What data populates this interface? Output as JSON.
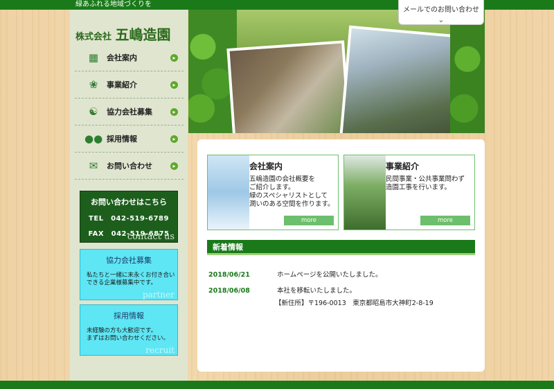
{
  "header": {
    "tagline": "緑あふれる地域づくりを",
    "mail_tab": "メールでのお問い合わせ"
  },
  "sidebar": {
    "logo_prefix": "株式会社",
    "logo_name": "五嶋造園",
    "nav": [
      {
        "label": "会社案内",
        "icon": "building-icon"
      },
      {
        "label": "事業紹介",
        "icon": "plant-icon"
      },
      {
        "label": "協力会社募集",
        "icon": "handshake-icon"
      },
      {
        "label": "採用情報",
        "icon": "people-icon"
      },
      {
        "label": "お問い合わせ",
        "icon": "mail-icon"
      }
    ],
    "contact": {
      "heading": "お問い合わせはこちら",
      "tel": "TEL　042-519-6789",
      "fax": "FAX　042-519-6875",
      "sub": "contact us"
    },
    "partner": {
      "heading": "協力会社募集",
      "text1": "私たちと一緒に末永くお付き合い",
      "text2": "できる企業様募集中です。",
      "sub": "partner"
    },
    "recruit": {
      "heading": "採用情報",
      "text1": "未経験の方も大歓迎です。",
      "text2": "まずはお問い合わせください。",
      "sub": "recruit"
    }
  },
  "cards": [
    {
      "title": "会社案内",
      "line1": "五嶋造園の会社概要を",
      "line2": "ご紹介します。",
      "line3": "緑のスペシャリストとして",
      "line4": "潤いのある空間を作ります。",
      "more": "more"
    },
    {
      "title": "事業紹介",
      "line1": "民間事業・公共事業問わず",
      "line2": "造園工事を行います。",
      "more": "more"
    }
  ],
  "news": {
    "heading": "新着情報",
    "items": [
      {
        "date": "2018/06/21",
        "text": "ホームページを公開いたしました。"
      },
      {
        "date": "2018/06/08",
        "text": "本社を移転いたしました。",
        "sub": "【新住所】〒196-0013　東京都昭島市大神町2-8-19"
      }
    ]
  },
  "colors": {
    "primary_green": "#1a7a1a",
    "accent_green": "#6cbf6c",
    "cyan": "#5ee6f4"
  }
}
